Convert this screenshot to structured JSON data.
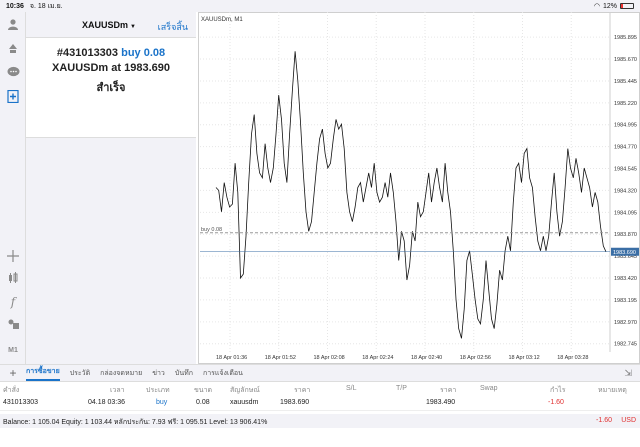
{
  "statusbar": {
    "time": "10:36",
    "date": "จ. 18 เม.ย.",
    "battery": "12%"
  },
  "panel": {
    "symbol": "XAUUSDm",
    "done_label": "เสร็จสิ้น",
    "result": {
      "order": "#431013303",
      "action": "buy 0.08",
      "line2_prefix": "XAUUSDm at",
      "price": "1983.690",
      "status": "สำเร็จ"
    }
  },
  "sidebar": {
    "timeframe": "M1"
  },
  "chart_data": {
    "type": "line",
    "title": "XAUUSDm, M1",
    "series": [
      {
        "values": [
          1984.35,
          1984.32,
          1984.1,
          1984.4,
          1984.25,
          1984.15,
          1984.18,
          1984.6,
          1984.3,
          1983.42,
          1983.46,
          1983.85,
          1984.4,
          1984.9,
          1985.1,
          1984.7,
          1984.5,
          1984.45,
          1984.8,
          1984.55,
          1984.4,
          1984.55,
          1984.9,
          1985.3,
          1985.05,
          1984.6,
          1984.4,
          1984.9,
          1985.35,
          1985.75,
          1985.45,
          1985.02,
          1984.5,
          1984.1,
          1983.9,
          1984.0,
          1984.3,
          1984.6,
          1984.85,
          1984.95,
          1984.7,
          1984.55,
          1984.6,
          1984.85,
          1985.05,
          1984.95,
          1985.0,
          1984.75,
          1984.3,
          1984.1,
          1984.0,
          1984.15,
          1984.35,
          1984.4,
          1984.2,
          1984.35,
          1984.5,
          1984.35,
          1984.6,
          1984.3,
          1984.2,
          1984.25,
          1984.4,
          1984.25,
          1984.5,
          1984.3,
          1984.0,
          1983.6,
          1983.9,
          1983.8,
          1983.4,
          1983.55,
          1983.9,
          1983.8,
          1984.2,
          1984.05,
          1984.1,
          1984.3,
          1984.5,
          1984.2,
          1984.4,
          1984.55,
          1984.35,
          1984.2,
          1984.6,
          1984.3,
          1984.1,
          1983.7,
          1983.2,
          1982.9,
          1982.8,
          1983.1,
          1983.6,
          1983.7,
          1983.45,
          1983.2,
          1983.0,
          1982.95,
          1983.2,
          1983.6,
          1983.3,
          1983.0,
          1982.9,
          1983.15,
          1983.5,
          1983.4,
          1983.7,
          1983.85,
          1983.7,
          1984.2,
          1984.55,
          1984.6,
          1984.4,
          1984.7,
          1984.75,
          1984.45,
          1984.35,
          1984.05,
          1983.8,
          1983.7,
          1983.85,
          1983.7,
          1983.85,
          1984.2,
          1984.5,
          1984.1,
          1983.85,
          1984.0,
          1984.35,
          1984.75,
          1984.55,
          1984.45,
          1984.65,
          1984.5,
          1984.3,
          1984.55,
          1984.45,
          1984.35,
          1984.15,
          1984.3,
          1984.2,
          1983.95,
          1983.75,
          1983.69
        ]
      }
    ],
    "x_ticks": [
      "18 Apr 01:36",
      "18 Apr 01:52",
      "18 Apr 02:08",
      "18 Apr 02:24",
      "18 Apr 02:40",
      "18 Apr 02:56",
      "18 Apr 03:12",
      "18 Apr 03:28"
    ],
    "y_ticks": [
      "1985.895",
      "1985.670",
      "1985.445",
      "1985.220",
      "1984.995",
      "1984.770",
      "1984.545",
      "1984.320",
      "1984.095",
      "1983.870",
      "1983.645",
      "1983.420",
      "1983.195",
      "1982.970",
      "1982.745"
    ],
    "ylim": [
      1982.66,
      1986.03
    ],
    "grid": true,
    "position_line": {
      "label": "buy 0.08",
      "value": 1983.69
    },
    "current_price": "1983.690"
  },
  "tabs": {
    "items": [
      "การซื้อขาย",
      "ประวัติ",
      "กล่องจดหมาย",
      "ข่าว",
      "บันทึก",
      "การแจ้งเตือน"
    ],
    "active": 0
  },
  "table": {
    "headers": [
      "คำสั่ง",
      "เวลา",
      "ประเภท",
      "ขนาด",
      "สัญลักษณ์",
      "ราคา",
      "S/L",
      "T/P",
      "ราคา",
      "Swap",
      "กำไร",
      "หมายเหตุ"
    ],
    "row": {
      "order": "431013303",
      "time": "04.18 03:36",
      "type": "buy",
      "size": "0.08",
      "symbol": "xauusdm",
      "open_price": "1983.690",
      "current_price": "1983.490",
      "profit": "-1.60"
    }
  },
  "balance": {
    "text": "Balance: 1 105.04 Equity: 1 103.44 หลักประกัน: 7.93 ฟรี: 1 095.51 Level: 13 906.41%",
    "profit": "-1.60",
    "currency": "USD"
  }
}
